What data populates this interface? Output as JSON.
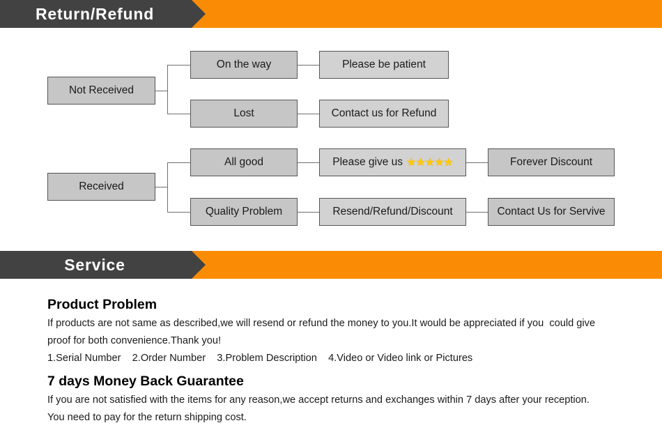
{
  "colors": {
    "banner_dark": "#424242",
    "banner_orange": "#fa8c05",
    "node_fill": "#c6c6c6",
    "node_fill_light": "#d2d2d2",
    "node_border": "#555555",
    "connector": "#6e6e6e",
    "star": "#ffc907"
  },
  "banners": [
    {
      "title": "Return/Refund"
    },
    {
      "title": "Service"
    }
  ],
  "flowchart": {
    "branches": [
      {
        "root": "Not Received",
        "rows": [
          {
            "stage": "On the way",
            "action": "Please be patient"
          },
          {
            "stage": "Lost",
            "action": "Contact us for Refund"
          }
        ]
      },
      {
        "root": "Received",
        "rows": [
          {
            "stage": "All good",
            "action": "Please give us ",
            "stars": "★★★★★",
            "result": "Forever Discount"
          },
          {
            "stage": "Quality Problem",
            "action": "Resend/Refund/Discount",
            "result": "Contact Us for Servive"
          }
        ]
      }
    ]
  },
  "service": {
    "sections": [
      {
        "heading": "Product Problem",
        "lines": [
          "If products are not same as described,we will resend or refund the money to you.It would be appreciated if you  could give",
          "proof for both convenience.Thank you!",
          "1.Serial Number    2.Order Number    3.Problem Description    4.Video or Video link or Pictures"
        ]
      },
      {
        "heading": "7 days Money Back Guarantee",
        "lines": [
          "If you are not satisfied with the items for any reason,we accept returns and exchanges within 7 days after your reception.",
          "You need to pay for the return shipping cost."
        ]
      }
    ]
  }
}
